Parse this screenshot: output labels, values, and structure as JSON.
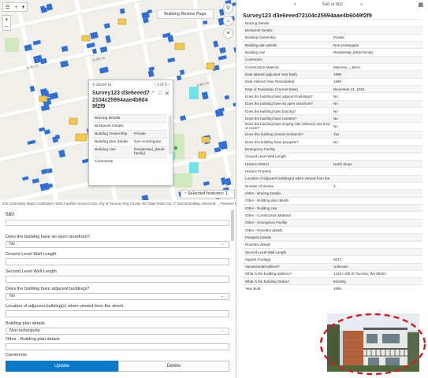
{
  "map": {
    "toolbar_icons": [
      "layers-icon",
      "plus-icon",
      "chevron-down-icon"
    ],
    "zoom_in": "+",
    "zoom_out": "–",
    "layer_tag": "Building Review Page",
    "right_tools": [
      "search-icon",
      "home-icon",
      "list-icon"
    ],
    "attribution": "Esri Community Maps Contributors, WSU Facilities Services GIS, City of Tacoma, King County, WA State Parks GIS, © OpenStreetMap, Microsoft, ...   Powered by Esri",
    "selected_features": "Selected features: 1",
    "popup": {
      "zoom_to": "Zoom to",
      "counter": "1 of 5",
      "title": "Survey123 d3e6eeed72104c25994aae4b6049f2f9",
      "rows": [
        {
          "key": "Bracing Details",
          "value": ""
        },
        {
          "key": "Brickwork Details",
          "value": ""
        },
        {
          "key": "Building Ownership",
          "value": "Private"
        },
        {
          "key": "Building plan details",
          "value": "Non-rectangular"
        },
        {
          "key": "Building Use",
          "value": "Residential_(Multi-family)"
        },
        {
          "key": "Comments",
          "value": ""
        }
      ]
    }
  },
  "form": {
    "record_id": "580",
    "fields": [
      {
        "label": "Does the building have an open storefront?",
        "value": "No",
        "type": "select"
      },
      {
        "label": "Ground Level Wall Length",
        "value": "",
        "type": "text"
      },
      {
        "label": "Second Level Wall Length",
        "value": "",
        "type": "text"
      },
      {
        "label": "Does the building have adjacent buildings?",
        "value": "No",
        "type": "select"
      },
      {
        "label": "Location of adjacent building(s) when viewed from the street.",
        "value": "",
        "type": "text"
      },
      {
        "label": "Building plan details",
        "value": "Non-rectangular",
        "type": "select"
      },
      {
        "label": "Other - Building plan details",
        "value": "",
        "type": "text"
      },
      {
        "label": "Comments",
        "value": "",
        "type": "text"
      }
    ],
    "update_label": "Update",
    "delete_label": "Delete"
  },
  "panel": {
    "nav_text": "546 of 862",
    "prev": "<",
    "next": ">",
    "title": "Survey123 d3e6eeed72104c25994aae4b6049f2f9",
    "rows": [
      {
        "key": "Bracing Details",
        "value": ""
      },
      {
        "key": "Brickwork Details",
        "value": ""
      },
      {
        "key": "Building Ownership",
        "value": "Private"
      },
      {
        "key": "Building plan details",
        "value": "Non-rectangular"
      },
      {
        "key": "Building Use",
        "value": "Residential_(Multi-family)"
      },
      {
        "key": "Comments",
        "value": ""
      },
      {
        "key": "Construction Material",
        "value": "Masonry_-_Brick"
      },
      {
        "key": "Date altered (adjusted Year Built)",
        "value": "1998"
      },
      {
        "key": "Date Altered (Year Remodeled)",
        "value": "1998"
      },
      {
        "key": "Date of Evaluation (Current Date)",
        "value": "December 21, 2024"
      },
      {
        "key": "Does the building have adjacent buildings?",
        "value": "No"
      },
      {
        "key": "Does the building have an open storefront?",
        "value": "No"
      },
      {
        "key": "Does the building have bracing?",
        "value": "No"
      },
      {
        "key": "Does the building have rosettes?",
        "value": "No"
      },
      {
        "key": "Does the building have sloping side offset by one floor or more?",
        "value": "No"
      },
      {
        "key": "Does this building contain brickwork?",
        "value": "Yes"
      },
      {
        "key": "Does this building have parapets?",
        "value": "No"
      },
      {
        "key": "Emergency Facility",
        "value": ""
      },
      {
        "key": "Ground Level Wall Length",
        "value": ""
      },
      {
        "key": "Historic District",
        "value": "North Slope"
      },
      {
        "key": "Historic Property",
        "value": ""
      },
      {
        "key": "Location of adjacent building(s) when viewed from the street...",
        "value": ""
      },
      {
        "key": "Number of Stories",
        "value": "2"
      },
      {
        "key": "Other - Bracing Details",
        "value": ""
      },
      {
        "key": "Other - Building plan details",
        "value": ""
      },
      {
        "key": "Other - Building Use",
        "value": ""
      },
      {
        "key": "Other - Construction Material",
        "value": ""
      },
      {
        "key": "Other - Emergency Facility",
        "value": ""
      },
      {
        "key": "Other - Rosettes details",
        "value": ""
      },
      {
        "key": "Parapets Details",
        "value": ""
      },
      {
        "key": "Rosettes details",
        "value": ""
      },
      {
        "key": "Second Level Wall Length",
        "value": ""
      },
      {
        "key": "Square Footage",
        "value": "6673"
      },
      {
        "key": "Vacant/Underutilized?",
        "value": "Unknown"
      },
      {
        "key": "What is the building address?",
        "value": "1216 n 6th St Tacoma, WA 98403"
      },
      {
        "key": "What is the Building Status?",
        "value": "Existing"
      },
      {
        "key": "Year Built",
        "value": "1959"
      }
    ]
  },
  "colors": {
    "accent": "#0a79c7",
    "annotation": "#e0131b",
    "building": "#2f6fd6",
    "highlight": "#f2c94c",
    "park": "#cfe8c0"
  }
}
